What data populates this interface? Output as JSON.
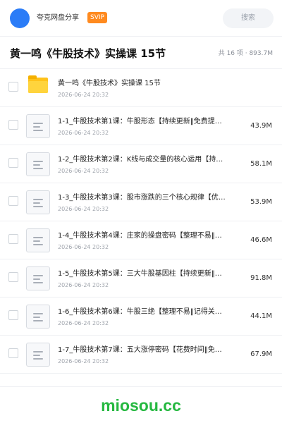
{
  "header": {
    "share_name": "夸克网盘分享",
    "badge": "SVIP",
    "search_placeholder": "搜索",
    "avatar_color": "#2b7cf7"
  },
  "title_bar": {
    "title": "黄一鸣《牛股技术》实操课 15节",
    "summary": "共 16 项 · 893.7M"
  },
  "items": [
    {
      "type": "folder",
      "icon": "folder-icon",
      "name": "黄一鸣《牛股技术》实操课 15节",
      "date": "2026-06-24 20:32",
      "size": ""
    },
    {
      "type": "file",
      "icon": "document-icon",
      "name": "1-1_牛股技术第1课：牛股形态【持续更新‖免费提…",
      "date": "2026-06-24 20:32",
      "size": "43.9M"
    },
    {
      "type": "file",
      "icon": "document-icon",
      "name": "1-2_牛股技术第2课：K线与成交量的核心运用【持…",
      "date": "2026-06-24 20:32",
      "size": "58.1M"
    },
    {
      "type": "file",
      "icon": "document-icon",
      "name": "1-3_牛股技术第3课：股市涨跌的三个核心规律【优…",
      "date": "2026-06-24 20:32",
      "size": "53.9M"
    },
    {
      "type": "file",
      "icon": "document-icon",
      "name": "1-4_牛股技术第4课：庄家的操盘密码【整理不易‖…",
      "date": "2026-06-24 20:32",
      "size": "46.6M"
    },
    {
      "type": "file",
      "icon": "document-icon",
      "name": "1-5_牛股技术第5课：三大牛股基因柱【持续更新‖…",
      "date": "2026-06-24 20:32",
      "size": "91.8M"
    },
    {
      "type": "file",
      "icon": "document-icon",
      "name": "1-6_牛股技术第6课：牛股三绝【整理不易‖记得关…",
      "date": "2026-06-24 20:32",
      "size": "44.1M"
    },
    {
      "type": "file",
      "icon": "document-icon",
      "name": "1-7_牛股技术第7课：五大涨停密码【花费时间‖免…",
      "date": "2026-06-24 20:32",
      "size": "67.9M"
    }
  ],
  "footer": {
    "watermark": "miosou.cc",
    "watermark_color": "#25b840"
  }
}
